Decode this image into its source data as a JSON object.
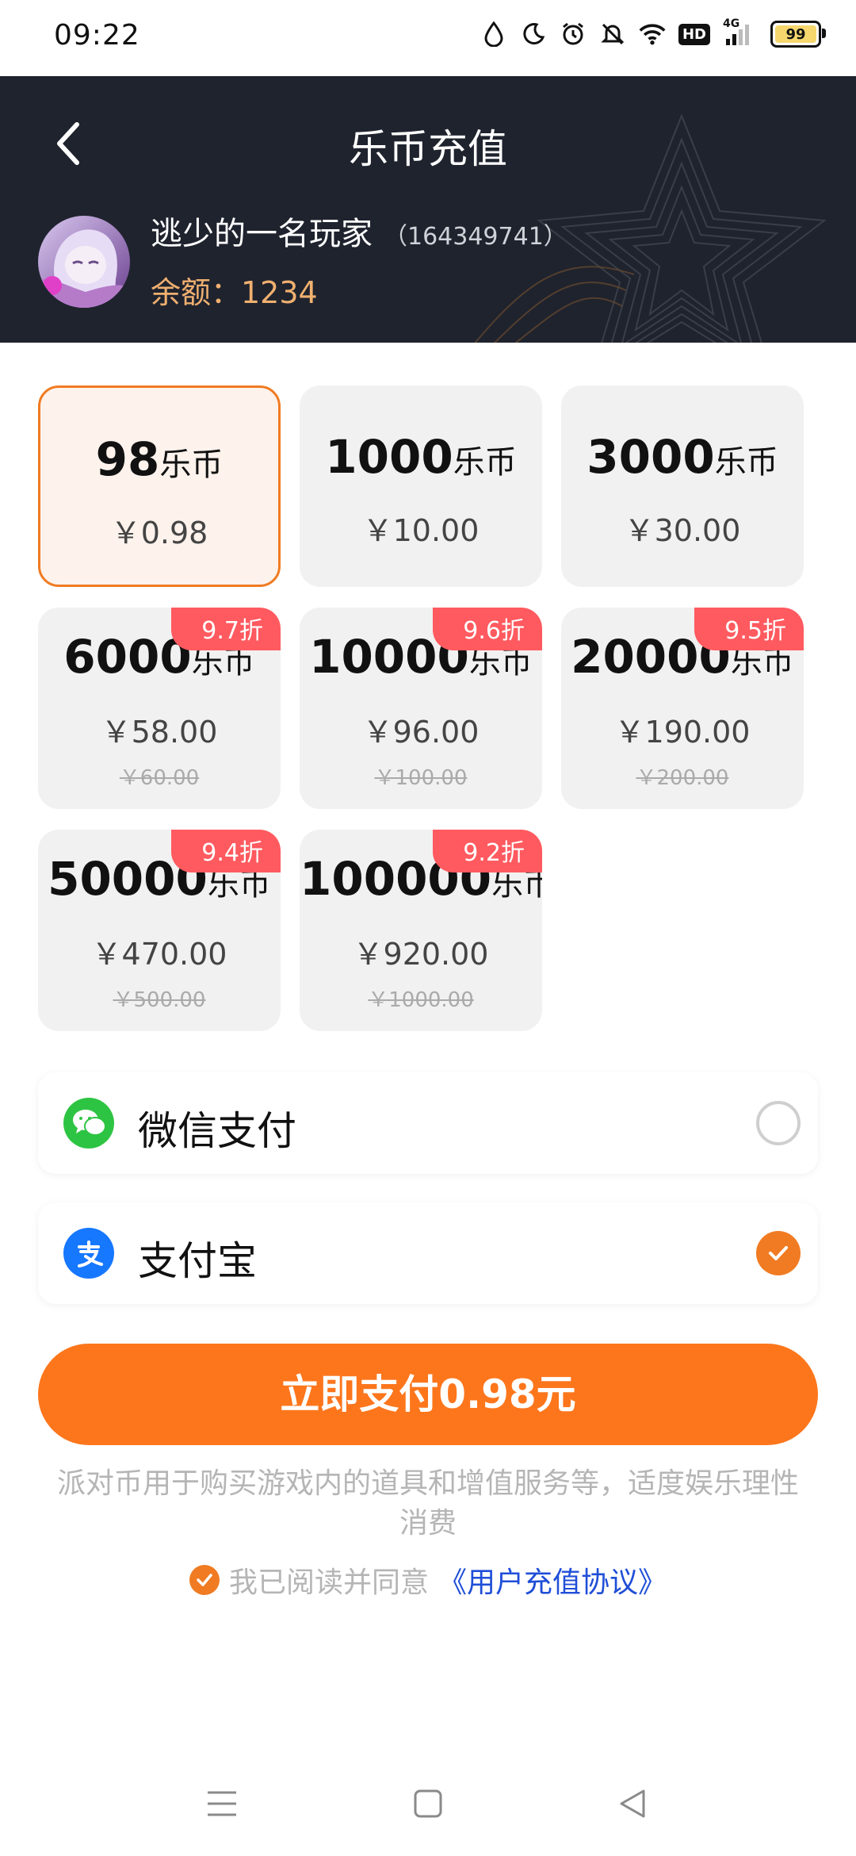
{
  "status_bar": {
    "time": "09:22",
    "network": "4G",
    "hd": "HD",
    "battery": "99"
  },
  "header": {
    "title": "乐币充值",
    "username": "逃少的一名玩家",
    "user_id": "（164349741）",
    "balance": "余额：1234"
  },
  "packages": [
    {
      "amount": "98",
      "unit": "乐币",
      "price": "￥0.98",
      "selected": true
    },
    {
      "amount": "1000",
      "unit": "乐币",
      "price": "￥10.00"
    },
    {
      "amount": "3000",
      "unit": "乐币",
      "price": "￥30.00"
    },
    {
      "amount": "6000",
      "unit": "乐币",
      "price": "￥58.00",
      "original": "￥60.00",
      "discount": "9.7折"
    },
    {
      "amount": "10000",
      "unit": "乐币",
      "price": "￥96.00",
      "original": "￥100.00",
      "discount": "9.6折"
    },
    {
      "amount": "20000",
      "unit": "乐币",
      "price": "￥190.00",
      "original": "￥200.00",
      "discount": "9.5折"
    },
    {
      "amount": "50000",
      "unit": "乐币",
      "price": "￥470.00",
      "original": "￥500.00",
      "discount": "9.4折"
    },
    {
      "amount": "100000",
      "unit": "乐币",
      "price": "￥920.00",
      "original": "￥1000.00",
      "discount": "9.2折"
    }
  ],
  "payment_methods": [
    {
      "label": "微信支付",
      "icon": "wechat-icon",
      "selected": false
    },
    {
      "label": "支付宝",
      "icon": "alipay-icon",
      "selected": true
    }
  ],
  "pay_button": "立即支付0.98元",
  "notice": "派对币用于购买游戏内的道具和增值服务等，适度娱乐理性消费",
  "agreement": {
    "text": "我已阅读并同意",
    "link": "《用户充值协议》"
  },
  "colors": {
    "accent": "#fd761c",
    "header_bg": "#1f232e",
    "discount_badge": "#ff5a5f",
    "link": "#1f4ed8"
  }
}
